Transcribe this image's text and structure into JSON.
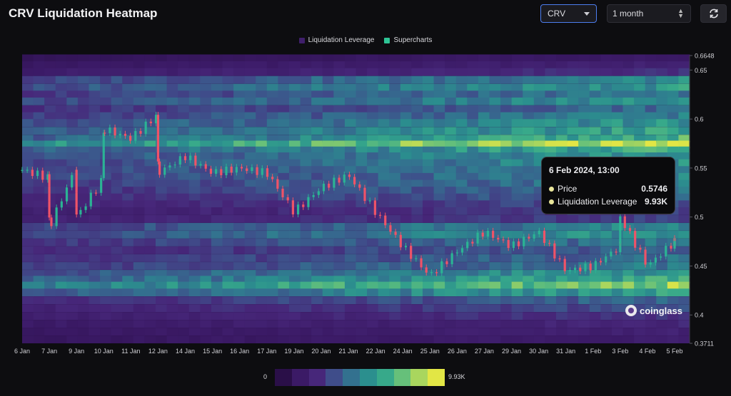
{
  "header": {
    "title": "CRV Liquidation Heatmap",
    "symbol": "CRV",
    "range": "1 month"
  },
  "legend": [
    {
      "label": "Liquidation Leverage",
      "color": "#3f1f6b"
    },
    {
      "label": "Supercharts",
      "color": "#2ec495"
    }
  ],
  "tooltip": {
    "title": "6 Feb 2024, 13:00",
    "price_label": "Price",
    "price_value": "0.5746",
    "lev_label": "Liquidation Leverage",
    "lev_value": "9.93K",
    "dot_color": "#e8e59a"
  },
  "brand": "coinglass",
  "scale": {
    "min_label": "0",
    "max_label": "9.93K",
    "colors": [
      "#2a0f48",
      "#3b1a66",
      "#47277a",
      "#3f4d8a",
      "#33718f",
      "#2b8f8e",
      "#37a98a",
      "#66c07a",
      "#a9d65e",
      "#e2e645"
    ]
  },
  "colors": {
    "up": "#2bb394",
    "down": "#ef5368",
    "background": "#0d0d10",
    "heat_low": "#3b1a66",
    "heat_mid": "#2e8d8c",
    "heat_high": "#e2e645"
  },
  "chart_data": {
    "type": "heatmap",
    "title": "CRV Liquidation Heatmap",
    "x_labels": [
      "6 Jan",
      "7 Jan",
      "9 Jan",
      "10 Jan",
      "11 Jan",
      "12 Jan",
      "14 Jan",
      "15 Jan",
      "16 Jan",
      "17 Jan",
      "19 Jan",
      "20 Jan",
      "21 Jan",
      "22 Jan",
      "24 Jan",
      "25 Jan",
      "26 Jan",
      "27 Jan",
      "29 Jan",
      "30 Jan",
      "31 Jan",
      "1 Feb",
      "3 Feb",
      "4 Feb",
      "5 Feb"
    ],
    "y_ticks": [
      0.65,
      0.6,
      0.55,
      0.5,
      0.45,
      0.4
    ],
    "y_range": [
      0.3711,
      0.6648
    ],
    "y_range_labels": [
      "0.3711",
      "0.6648"
    ],
    "color_scale": [
      0,
      9930
    ],
    "price_series": {
      "label": "CRV price",
      "points": [
        [
          "6 Jan",
          0.548
        ],
        [
          "7 Jan",
          0.54
        ],
        [
          "7 Jan",
          0.49
        ],
        [
          "9 Jan",
          0.552
        ],
        [
          "9 Jan",
          0.5
        ],
        [
          "10 Jan",
          0.54
        ],
        [
          "10 Jan",
          0.59
        ],
        [
          "11 Jan",
          0.58
        ],
        [
          "12 Jan",
          0.605
        ],
        [
          "12 Jan",
          0.545
        ],
        [
          "14 Jan",
          0.562
        ],
        [
          "15 Jan",
          0.545
        ],
        [
          "16 Jan",
          0.55
        ],
        [
          "17 Jan",
          0.545
        ],
        [
          "19 Jan",
          0.505
        ],
        [
          "20 Jan",
          0.53
        ],
        [
          "21 Jan",
          0.543
        ],
        [
          "22 Jan",
          0.505
        ],
        [
          "24 Jan",
          0.47
        ],
        [
          "25 Jan",
          0.44
        ],
        [
          "26 Jan",
          0.465
        ],
        [
          "27 Jan",
          0.485
        ],
        [
          "29 Jan",
          0.47
        ],
        [
          "30 Jan",
          0.485
        ],
        [
          "31 Jan",
          0.445
        ],
        [
          "1 Feb",
          0.45
        ],
        [
          "3 Feb",
          0.47
        ],
        [
          "3 Feb",
          0.5
        ],
        [
          "4 Feb",
          0.45
        ],
        [
          "5 Feb",
          0.475
        ],
        [
          "5 Feb",
          0.472
        ]
      ]
    },
    "heat_bands": [
      {
        "price": 0.662,
        "level": 0.12
      },
      {
        "price": 0.655,
        "level": 0.18
      },
      {
        "price": 0.648,
        "level": 0.25
      },
      {
        "price": 0.64,
        "level": 0.55
      },
      {
        "price": 0.632,
        "level": 0.62
      },
      {
        "price": 0.625,
        "level": 0.5
      },
      {
        "price": 0.618,
        "level": 0.58
      },
      {
        "price": 0.61,
        "level": 0.45
      },
      {
        "price": 0.603,
        "level": 0.52
      },
      {
        "price": 0.596,
        "level": 0.6
      },
      {
        "price": 0.588,
        "level": 0.66
      },
      {
        "price": 0.58,
        "level": 0.72
      },
      {
        "price": 0.574,
        "level": 1.0
      },
      {
        "price": 0.568,
        "level": 0.7
      },
      {
        "price": 0.562,
        "level": 0.62
      },
      {
        "price": 0.555,
        "level": 0.58
      },
      {
        "price": 0.548,
        "level": 0.55
      },
      {
        "price": 0.541,
        "level": 0.52
      },
      {
        "price": 0.534,
        "level": 0.5
      },
      {
        "price": 0.527,
        "level": 0.45
      },
      {
        "price": 0.52,
        "level": 0.42
      },
      {
        "price": 0.513,
        "level": 0.35
      },
      {
        "price": 0.506,
        "level": 0.3
      },
      {
        "price": 0.498,
        "level": 0.32
      },
      {
        "price": 0.49,
        "level": 0.55
      },
      {
        "price": 0.482,
        "level": 0.6
      },
      {
        "price": 0.474,
        "level": 0.48
      },
      {
        "price": 0.466,
        "level": 0.4
      },
      {
        "price": 0.458,
        "level": 0.45
      },
      {
        "price": 0.45,
        "level": 0.5
      },
      {
        "price": 0.442,
        "level": 0.62
      },
      {
        "price": 0.436,
        "level": 0.7
      },
      {
        "price": 0.43,
        "level": 0.88
      },
      {
        "price": 0.423,
        "level": 0.66
      },
      {
        "price": 0.415,
        "level": 0.42
      },
      {
        "price": 0.407,
        "level": 0.34
      },
      {
        "price": 0.399,
        "level": 0.28
      },
      {
        "price": 0.391,
        "level": 0.22
      },
      {
        "price": 0.383,
        "level": 0.18
      },
      {
        "price": 0.375,
        "level": 0.15
      }
    ]
  }
}
